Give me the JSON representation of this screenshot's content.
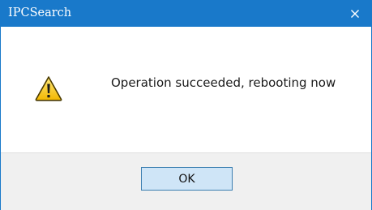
{
  "window": {
    "title": "IPCSearch",
    "close_icon": "close-icon",
    "accent_color": "#1979ca"
  },
  "dialog": {
    "icon": "warning-icon",
    "message": "Operation succeeded, rebooting now",
    "ok_label": "OK"
  }
}
